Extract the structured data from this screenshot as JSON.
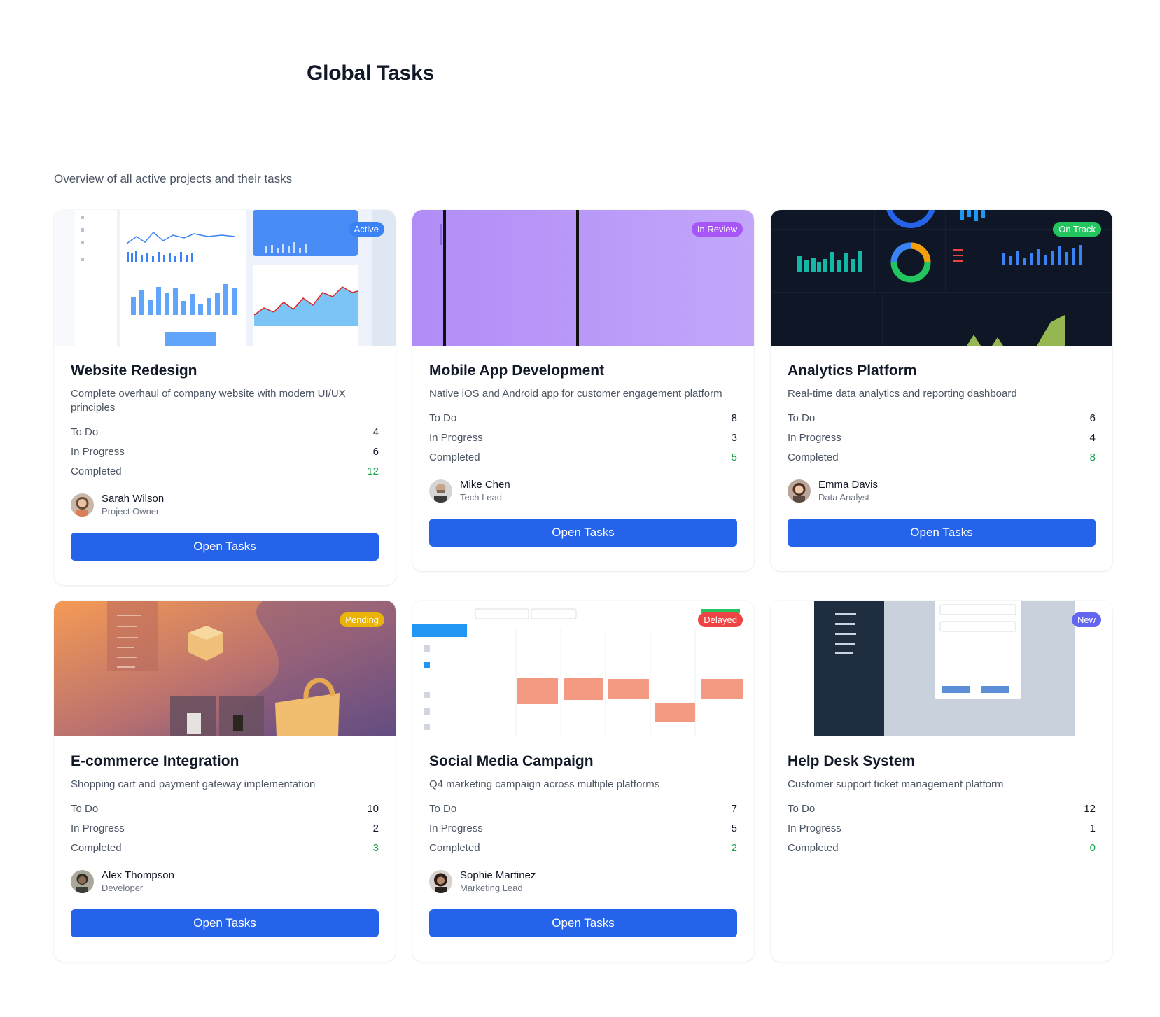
{
  "header": {
    "title": "Global Tasks",
    "subtitle": "Overview of all active projects and their tasks"
  },
  "colors": {
    "primary": "#2563eb",
    "completed": "#16a34a",
    "badge_active": "#3b82f6",
    "badge_review": "#a855f7",
    "badge_on_track": "#22c55e",
    "badge_pending": "#eab308",
    "badge_delayed": "#ef4444",
    "badge_new": "#6366f1"
  },
  "stat_labels": {
    "todo": "To Do",
    "in_progress": "In Progress",
    "completed": "Completed"
  },
  "projects": [
    {
      "title": "Website Redesign",
      "description": "Complete overhaul of company website with modern UI/UX principles",
      "status": "Active",
      "todo": "4",
      "in_progress": "6",
      "completed": "12",
      "owner": "Sarah Wilson",
      "role": "Project Owner",
      "button": "Open Tasks"
    },
    {
      "title": "Mobile App Development",
      "description": "Native iOS and Android app for customer engagement platform",
      "status": "In Review",
      "todo": "8",
      "in_progress": "3",
      "completed": "5",
      "owner": "Mike Chen",
      "role": "Tech Lead",
      "button": "Open Tasks"
    },
    {
      "title": "Analytics Platform",
      "description": "Real-time data analytics and reporting dashboard",
      "status": "On Track",
      "todo": "6",
      "in_progress": "4",
      "completed": "8",
      "owner": "Emma Davis",
      "role": "Data Analyst",
      "button": "Open Tasks"
    },
    {
      "title": "E-commerce Integration",
      "description": "Shopping cart and payment gateway implementation",
      "status": "Pending",
      "todo": "10",
      "in_progress": "2",
      "completed": "3",
      "owner": "Alex Thompson",
      "role": "Developer",
      "button": "Open Tasks"
    },
    {
      "title": "Social Media Campaign",
      "description": "Q4 marketing campaign across multiple platforms",
      "status": "Delayed",
      "todo": "7",
      "in_progress": "5",
      "completed": "2",
      "owner": "Sophie Martinez",
      "role": "Marketing Lead",
      "button": "Open Tasks"
    },
    {
      "title": "Help Desk System",
      "description": "Customer support ticket management platform",
      "status": "New",
      "todo": "12",
      "in_progress": "1",
      "completed": "0"
    }
  ]
}
